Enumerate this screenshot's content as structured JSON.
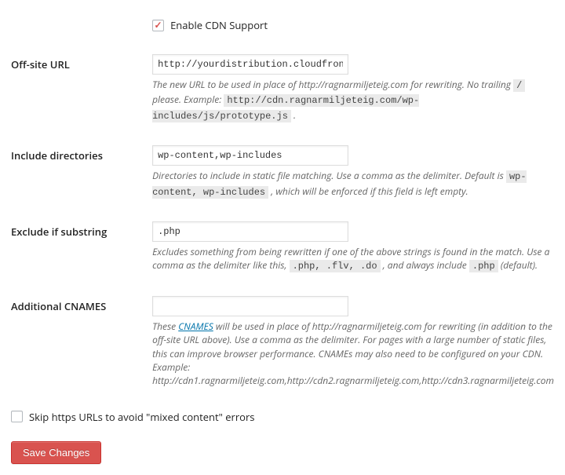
{
  "enable_cdn": {
    "label": "Enable CDN Support",
    "checked": true
  },
  "offsite_url": {
    "label": "Off-site URL",
    "value": "http://yourdistribution.cloudfront.net",
    "desc_before_code1": "The new URL to be used in place of http://ragnarmiljeteig.com for rewriting. No trailing ",
    "code1": "/",
    "desc_after_code1": " please. Example: ",
    "code2": "http://cdn.ragnarmiljeteig.com/wp-includes/js/prototype.js",
    "desc_tail": " ."
  },
  "include_dirs": {
    "label": "Include directories",
    "value": "wp-content,wp-includes",
    "desc_before": "Directories to include in static file matching. Use a comma as the delimiter. Default is ",
    "code": "wp-content, wp-includes",
    "desc_after": " , which will be enforced if this field is left empty."
  },
  "exclude": {
    "label": "Exclude if substring",
    "value": ".php",
    "desc_before": "Excludes something from being rewritten if one of the above strings is found in the match. Use a comma as the delimiter like this, ",
    "code1": ".php, .flv, .do",
    "desc_mid": " , and always include ",
    "code2": ".php",
    "desc_after": " (default)."
  },
  "cnames": {
    "label": "Additional CNAMES",
    "value": "",
    "desc_prefix": "These ",
    "link_text": "CNAMES",
    "desc_body": " will be used in place of http://ragnarmiljeteig.com for rewriting (in addition to the off-site URL above). Use a comma as the delimiter. For pages with a large number of static files, this can improve browser performance. CNAMEs may also need to be configured on your CDN.",
    "example_label": "Example:",
    "example_value": "http://cdn1.ragnarmiljeteig.com,http://cdn2.ragnarmiljeteig.com,http://cdn3.ragnarmiljeteig.com"
  },
  "skip_https": {
    "label": "Skip https URLs to avoid \"mixed content\" errors",
    "checked": false
  },
  "save_label": "Save Changes"
}
